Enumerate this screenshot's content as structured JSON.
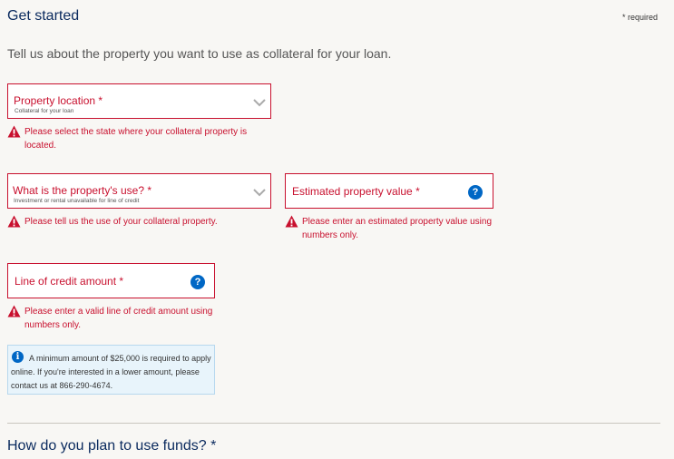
{
  "header": {
    "title": "Get started",
    "required_note": "* required"
  },
  "intro": "Tell us about the property you want to use as collateral for your loan.",
  "fields": {
    "property_location": {
      "label": "Property location *",
      "sublabel": "Collateral for your loan",
      "icon": "chevron-down-icon",
      "error": "Please select the state where your collateral property is located."
    },
    "property_use": {
      "label": "What is the property's use? *",
      "sublabel": "Investment or rental unavailable for line of credit",
      "icon": "chevron-down-icon",
      "error": "Please tell us the use of your collateral property."
    },
    "property_value": {
      "label": "Estimated property value *",
      "help_glyph": "?",
      "error": "Please enter an estimated property value using numbers only."
    },
    "credit_amount": {
      "label": "Line of credit amount *",
      "help_glyph": "?",
      "error": "Please enter a valid line of credit amount using numbers only."
    }
  },
  "info": {
    "icon": "info-icon",
    "glyph": "i",
    "text": "A minimum amount of $25,000 is required to apply online. If you're interested in a lower amount, please contact us at 866-290-4674."
  },
  "next_section": {
    "title": "How do you plan to use funds? *"
  },
  "colors": {
    "error": "#c8102e",
    "heading": "#0a2a5e",
    "help": "#0067c5",
    "info_bg": "#e8f4fb",
    "background": "#f8f7f4"
  }
}
